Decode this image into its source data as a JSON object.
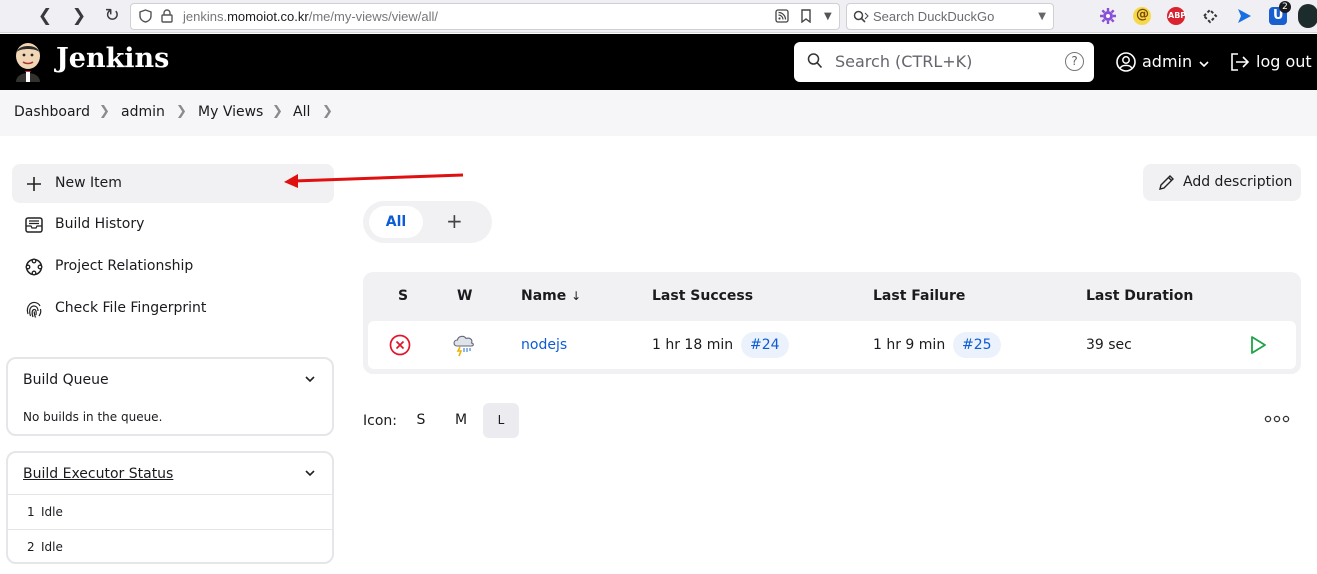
{
  "browser": {
    "url_prefix": "jenkins.",
    "url_host": "momoiot.co.kr",
    "url_path": "/me/my-views/view/all/",
    "search_placeholder": "Search DuckDuckGo",
    "ext_badge_count": "2"
  },
  "header": {
    "brand": "Jenkins",
    "search_placeholder": "Search (CTRL+K)",
    "help_label": "?",
    "user": "admin",
    "logout": "log out"
  },
  "breadcrumb": [
    "Dashboard",
    "admin",
    "My Views",
    "All"
  ],
  "sidebar": {
    "tasks": [
      {
        "label": "New Item",
        "icon": "plus-icon"
      },
      {
        "label": "Build History",
        "icon": "inbox-icon"
      },
      {
        "label": "Project Relationship",
        "icon": "relationship-icon"
      },
      {
        "label": "Check File Fingerprint",
        "icon": "fingerprint-icon"
      }
    ],
    "build_queue": {
      "title": "Build Queue",
      "empty_text": "No builds in the queue."
    },
    "executors": {
      "title": "Build Executor Status",
      "rows": [
        {
          "num": "1",
          "state": "Idle"
        },
        {
          "num": "2",
          "state": "Idle"
        }
      ]
    }
  },
  "main": {
    "add_description": "Add description",
    "tabs": [
      {
        "label": "All"
      }
    ],
    "add_tab": "+",
    "table": {
      "headers": {
        "s": "S",
        "w": "W",
        "name": "Name",
        "sort": "↓",
        "last_success": "Last Success",
        "last_failure": "Last Failure",
        "last_duration": "Last Duration"
      },
      "rows": [
        {
          "status": "failed-icon",
          "weather": "storm-icon",
          "name": "nodejs",
          "last_success": "1 hr 18 min",
          "last_success_build": "#24",
          "last_failure": "1 hr 9 min",
          "last_failure_build": "#25",
          "last_duration": "39 sec"
        }
      ]
    },
    "icon_size": {
      "label": "Icon:",
      "options": [
        "S",
        "M",
        "L"
      ],
      "selected": "L"
    }
  },
  "colors": {
    "link": "#0b5cd5",
    "failure": "#e0162b",
    "success_play": "#1ea446",
    "annotation_arrow": "#e01010"
  }
}
